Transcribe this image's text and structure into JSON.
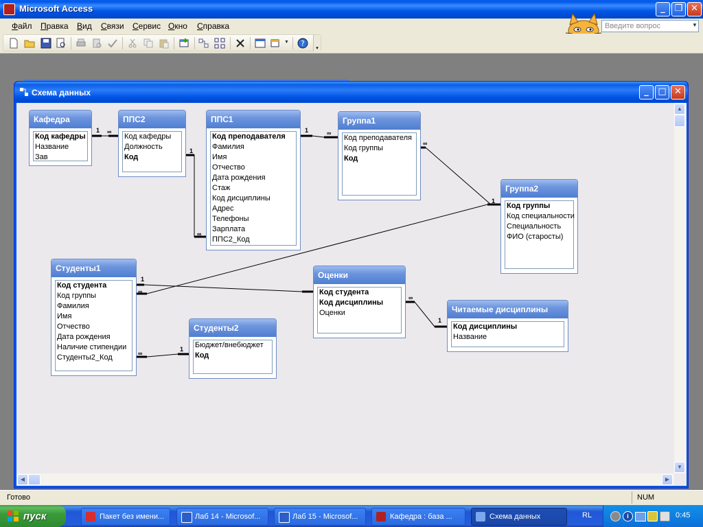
{
  "app": {
    "title": "Microsoft Access"
  },
  "menu": [
    "Файл",
    "Правка",
    "Вид",
    "Связи",
    "Сервис",
    "Окно",
    "Справка"
  ],
  "help_box": {
    "placeholder": "Введите вопрос"
  },
  "window": {
    "title": "Схема данных"
  },
  "tables": [
    {
      "id": "kafedra",
      "title": "Кафедра",
      "fields": [
        {
          "name": "Код кафедры",
          "key": true
        },
        {
          "name": "Название",
          "key": false
        },
        {
          "name": "Зав",
          "key": false
        }
      ]
    },
    {
      "id": "pps2",
      "title": "ППС2",
      "fields": [
        {
          "name": "Код кафедры",
          "key": false
        },
        {
          "name": "Должность",
          "key": false
        },
        {
          "name": "Код",
          "key": true
        }
      ]
    },
    {
      "id": "pps1",
      "title": "ППС1",
      "fields": [
        {
          "name": "Код преподавателя",
          "key": true
        },
        {
          "name": "Фамилия",
          "key": false
        },
        {
          "name": "Имя",
          "key": false
        },
        {
          "name": "Отчество",
          "key": false
        },
        {
          "name": "Дата рождения",
          "key": false
        },
        {
          "name": "Стаж",
          "key": false
        },
        {
          "name": "Код дисциплины",
          "key": false
        },
        {
          "name": "Адрес",
          "key": false
        },
        {
          "name": "Телефоны",
          "key": false
        },
        {
          "name": "Зарплата",
          "key": false
        },
        {
          "name": "ППС2_Код",
          "key": false
        }
      ]
    },
    {
      "id": "gruppa1",
      "title": "Группа1",
      "fields": [
        {
          "name": "Код преподавателя",
          "key": false
        },
        {
          "name": "Код группы",
          "key": false
        },
        {
          "name": "Код",
          "key": true
        }
      ]
    },
    {
      "id": "gruppa2",
      "title": "Группа2",
      "fields": [
        {
          "name": "Код группы",
          "key": true
        },
        {
          "name": "Код специальности",
          "key": false
        },
        {
          "name": "Специальность",
          "key": false
        },
        {
          "name": "ФИО (старосты)",
          "key": false
        }
      ]
    },
    {
      "id": "studenty1",
      "title": "Студенты1",
      "fields": [
        {
          "name": "Код студента",
          "key": true
        },
        {
          "name": "Код группы",
          "key": false
        },
        {
          "name": "Фамилия",
          "key": false
        },
        {
          "name": "Имя",
          "key": false
        },
        {
          "name": "Отчество",
          "key": false
        },
        {
          "name": "Дата рождения",
          "key": false
        },
        {
          "name": "Наличие стипендии",
          "key": false
        },
        {
          "name": "Студенты2_Код",
          "key": false
        }
      ]
    },
    {
      "id": "ocenki",
      "title": "Оценки",
      "fields": [
        {
          "name": "Код студента",
          "key": true
        },
        {
          "name": "Код дисциплины",
          "key": true
        },
        {
          "name": "Оценки",
          "key": false
        }
      ]
    },
    {
      "id": "studenty2",
      "title": "Студенты2",
      "fields": [
        {
          "name": "Бюджет/внебюджет",
          "key": false
        },
        {
          "name": "Код",
          "key": true
        }
      ]
    },
    {
      "id": "disc",
      "title": "Читаемые дисциплины",
      "fields": [
        {
          "name": "Код дисциплины",
          "key": true
        },
        {
          "name": "Название",
          "key": false
        }
      ]
    }
  ],
  "cardinality": {
    "one": "1",
    "many": "∞"
  },
  "status": {
    "text": "Готово",
    "num": "NUM"
  },
  "taskbar": {
    "start": "пуск",
    "tasks": [
      "Пакет без имени...",
      "Лаб 14 - Microsof...",
      "Лаб 15 - Microsof...",
      "Кафедра : база ...",
      "Схема данных"
    ],
    "lang": "RL",
    "clock": "0:45"
  },
  "colors": {
    "title_bar": "#0054e3",
    "table_header": "#6d95dd",
    "canvas": "#ece9ed",
    "start_green": "#3c9a3c"
  }
}
